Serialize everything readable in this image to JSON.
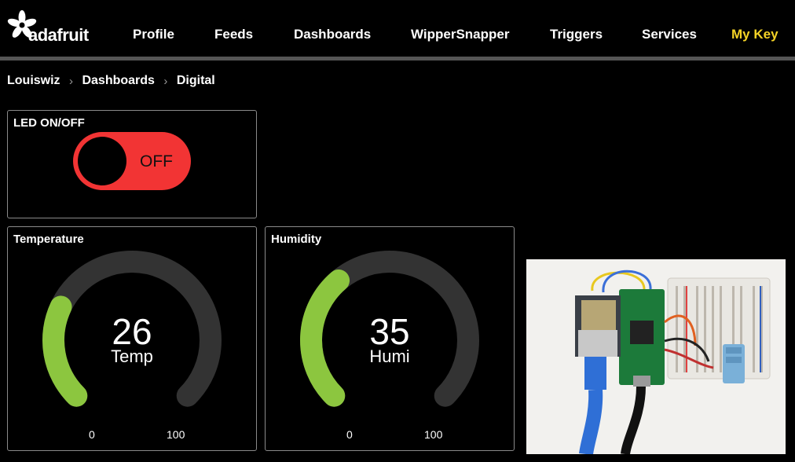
{
  "nav": {
    "brand": "adafruit",
    "items": [
      "Profile",
      "Feeds",
      "Dashboards",
      "WipperSnapper",
      "Triggers",
      "Services"
    ],
    "my_key": "My Key"
  },
  "breadcrumb": {
    "items": [
      "Louiswiz",
      "Dashboards",
      "Digital"
    ],
    "separator": "›"
  },
  "blocks": {
    "led": {
      "title": "LED ON/OFF",
      "state_label": "OFF",
      "state_color": "#f23434"
    },
    "temperature": {
      "title": "Temperature",
      "value": "26",
      "label": "Temp",
      "min": "0",
      "max": "100",
      "fraction": 0.26,
      "fill_color": "#8cc63f",
      "track_color": "#333333"
    },
    "humidity": {
      "title": "Humidity",
      "value": "35",
      "label": "Humi",
      "min": "0",
      "max": "100",
      "fraction": 0.35,
      "fill_color": "#8cc63f",
      "track_color": "#333333"
    }
  }
}
